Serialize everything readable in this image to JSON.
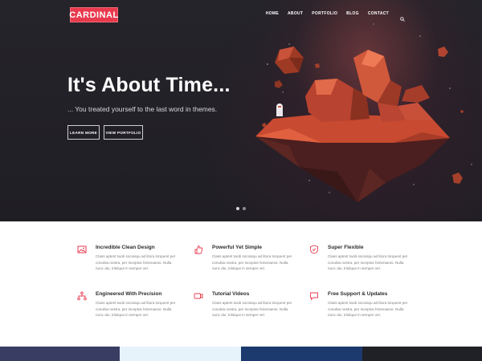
{
  "brand": {
    "logo_text": "CARDINAL",
    "accent": "#e8394d"
  },
  "nav": {
    "items": [
      "HOME",
      "ABOUT",
      "PORTFOLIO",
      "BLOG",
      "CONTACT"
    ],
    "search_icon": "search-icon"
  },
  "hero": {
    "title": "It's About Time...",
    "subtitle": "... You treated yourself to the last word in themes.",
    "buttons": {
      "learn_more": "LEARN MORE",
      "view_portfolio": "VIEW PORTFOLIO"
    },
    "slider": {
      "count": 2,
      "active_index": 0
    }
  },
  "features": [
    {
      "icon": "image-icon",
      "title": "Incredible Clean Design",
      "text": "Class aptent taciti sociosqu ad litora torquent per conubia nostra, per inceptos himenaeos. Nulla nunc dui, tristique in semper vel."
    },
    {
      "icon": "thumbs-up-icon",
      "title": "Powerful Yet Simple",
      "text": "Class aptent taciti sociosqu ad litora torquent per conubia nostra, per inceptos himenaeos. Nulla nunc dui, tristique in semper vel."
    },
    {
      "icon": "shield-icon",
      "title": "Super Flexible",
      "text": "Class aptent taciti sociosqu ad litora torquent per conubia nostra, per inceptos himenaeos. Nulla nunc dui, tristique in semper vel."
    },
    {
      "icon": "network-icon",
      "title": "Engineered With Precision",
      "text": "Class aptent taciti sociosqu ad litora torquent per conubia nostra, per inceptos himenaeos. Nulla nunc dui, tristique in semper vel."
    },
    {
      "icon": "video-icon",
      "title": "Tutorial Videos",
      "text": "Class aptent taciti sociosqu ad litora torquent per conubia nostra, per inceptos himenaeos. Nulla nunc dui, tristique in semper vel."
    },
    {
      "icon": "chat-icon",
      "title": "Free Support & Updates",
      "text": "Class aptent taciti sociosqu ad litora torquent per conubia nostra, per inceptos himenaeos. Nulla nunc dui, tristique in semper vel."
    }
  ],
  "strip_colors": [
    "#3a3d63",
    "#e6f3fb",
    "#1c3a6e",
    "#202126"
  ]
}
